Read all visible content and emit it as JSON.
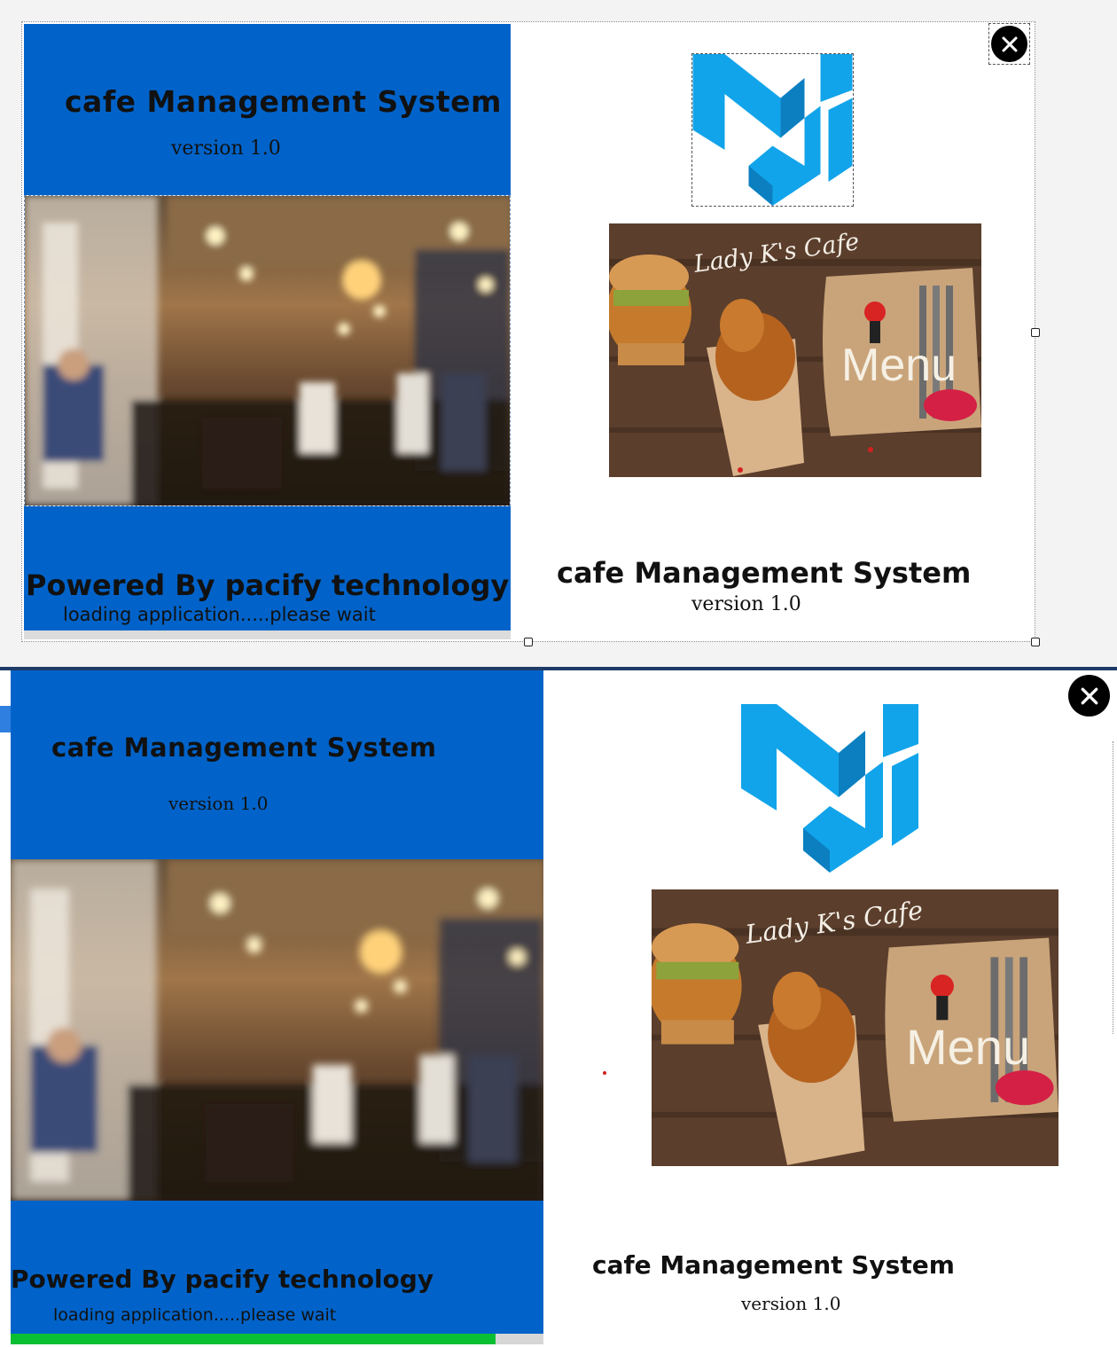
{
  "design_view": {
    "title": "cafe Management System",
    "version": "version 1.0",
    "footer_title": "Powered By pacify technology",
    "loading_text": "loading application.....please wait",
    "right_title": "cafe Management System",
    "right_version": "version 1.0",
    "menu_image": {
      "cafe_name": "Lady K's Cafe",
      "menu_word": "Menu"
    }
  },
  "runtime_view": {
    "title": "cafe Management System",
    "version": "version 1.0",
    "footer_title": "Powered By pacify technology",
    "loading_text": "loading application.....please wait",
    "progress": 0.91,
    "right_title": "cafe Management System",
    "right_version": "version 1.0",
    "menu_image": {
      "cafe_name": "Lady K's Cafe",
      "menu_word": "Menu"
    }
  },
  "colors": {
    "panel_blue": "#0163c9",
    "logo_blue": "#12a4ea",
    "progress_green": "#0bbf32"
  },
  "icons": [
    "close-icon",
    "logo-icon"
  ]
}
